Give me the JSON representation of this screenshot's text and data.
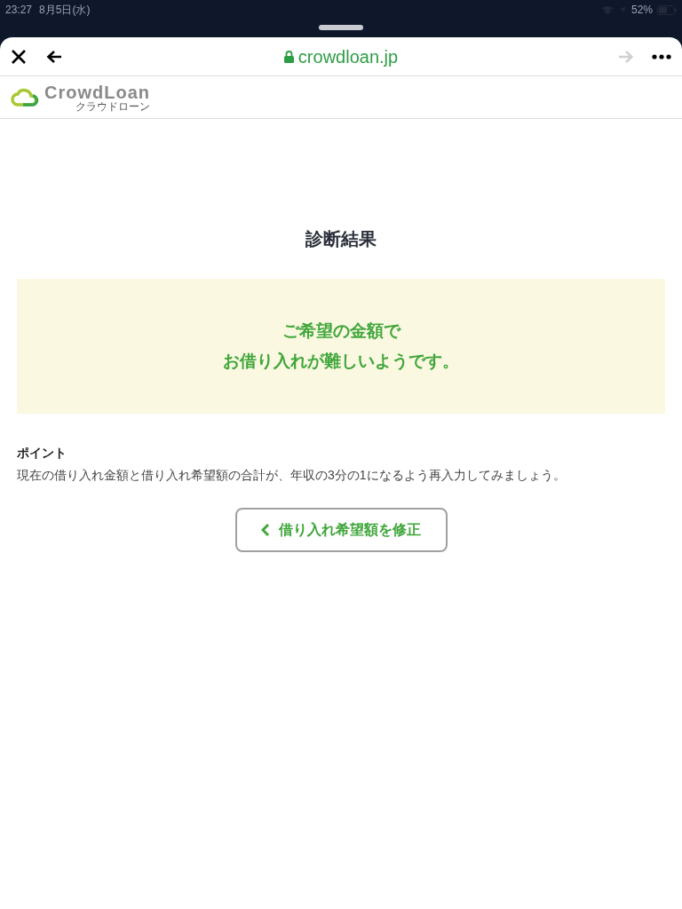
{
  "status_bar": {
    "time": "23:27",
    "date": "8月5日(水)",
    "battery": "52%"
  },
  "browser": {
    "url": "crowdloan.jp",
    "forward_disabled": true
  },
  "header": {
    "logo": "CrowdLoan",
    "logo_sub": "クラウドローン"
  },
  "page": {
    "title": "診断結果",
    "result_lines": [
      "ご希望の金額で",
      "お借り入れが難しいようです。"
    ],
    "point_label": "ポイント",
    "point_text": "現在の借り入れ金額と借り入れ希望額の合計が、年収の3分の1になるよう再入力してみましょう。",
    "button": "借り入れ希望額を修正"
  }
}
